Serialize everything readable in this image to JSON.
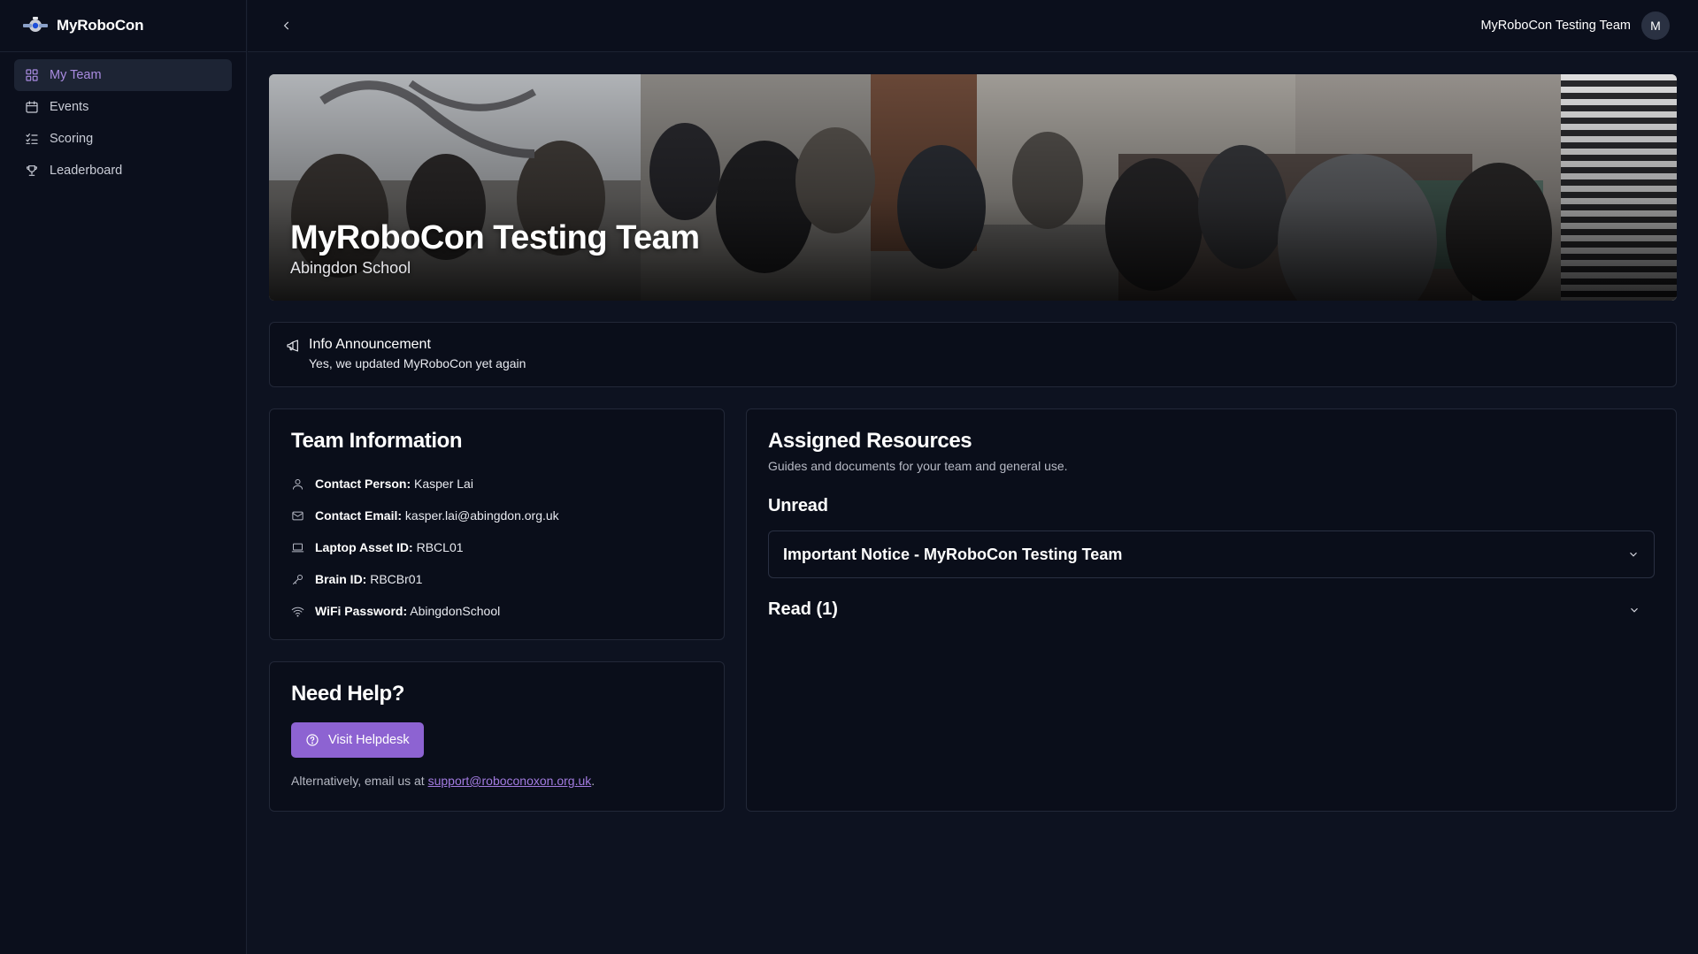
{
  "app": {
    "name": "MyRoboCon"
  },
  "colors": {
    "accent": "#8d63d2",
    "link": "#a27be0",
    "active_nav_text": "#a98be0",
    "background": "#0d1220"
  },
  "sidebar": {
    "items": [
      {
        "label": "My Team",
        "icon": "grid-icon",
        "active": true
      },
      {
        "label": "Events",
        "icon": "calendar-icon"
      },
      {
        "label": "Scoring",
        "icon": "list-checks-icon"
      },
      {
        "label": "Leaderboard",
        "icon": "trophy-icon"
      }
    ]
  },
  "topbar": {
    "user_name": "MyRoboCon Testing Team",
    "avatar_initial": "M"
  },
  "hero": {
    "title": "MyRoboCon Testing Team",
    "subtitle": "Abingdon School"
  },
  "announcement": {
    "title": "Info Announcement",
    "body": "Yes, we updated MyRoboCon yet again"
  },
  "team_info": {
    "title": "Team Information",
    "rows": [
      {
        "label": "Contact Person:",
        "value": "Kasper Lai",
        "icon": "user-icon"
      },
      {
        "label": "Contact Email:",
        "value": "kasper.lai@abingdon.org.uk",
        "icon": "mail-icon"
      },
      {
        "label": "Laptop Asset ID:",
        "value": "RBCL01",
        "icon": "laptop-icon"
      },
      {
        "label": "Brain ID:",
        "value": "RBCBr01",
        "icon": "key-icon"
      },
      {
        "label": "WiFi Password:",
        "value": "AbingdonSchool",
        "icon": "wifi-icon"
      }
    ]
  },
  "help": {
    "title": "Need Help?",
    "button_label": "Visit Helpdesk",
    "note_prefix": "Alternatively, email us at ",
    "email": "support@roboconoxon.org.uk",
    "note_suffix": "."
  },
  "resources": {
    "title": "Assigned Resources",
    "subtitle": "Guides and documents for your team and general use.",
    "unread_title": "Unread",
    "unread_items": [
      {
        "label": "Important Notice - MyRoboCon Testing Team"
      }
    ],
    "read_title": "Read (1)"
  }
}
